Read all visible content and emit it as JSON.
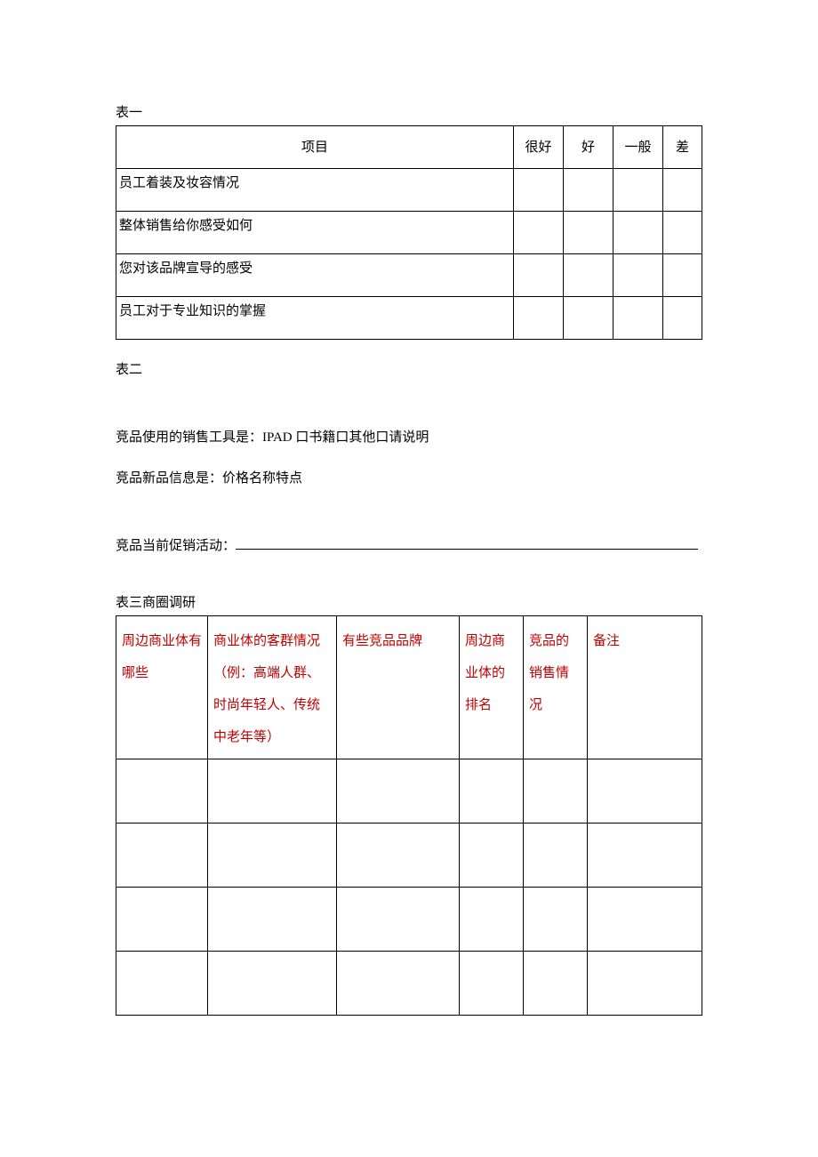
{
  "table1": {
    "label": "表一",
    "headers": {
      "item": "项目",
      "c1": "很好",
      "c2": "好",
      "c3": "一般",
      "c4": "差"
    },
    "rows": [
      "员工着装及妆容情况",
      "整体销售给你感受如何",
      "您对该品牌宣导的感受",
      "员工对于专业知识的掌握"
    ]
  },
  "section2": {
    "label": "表二",
    "line1": "竞品使用的销售工具是：IPAD 口书籍口其他口请说明",
    "line2": "竞品新品信息是：价格名称特点",
    "line3_prefix": "竞品当前促销活动："
  },
  "table3": {
    "label": "表三商圈调研",
    "headers": {
      "h0": "周边商业体有哪些",
      "h1": "商业体的客群情况（例：高端人群、时尚年轻人、传统中老年等）",
      "h2": "有些竞品品牌",
      "h3": "周边商业体的排名",
      "h4": "竞品的销售情况",
      "h5": "备注"
    },
    "empty_rows": 4
  }
}
